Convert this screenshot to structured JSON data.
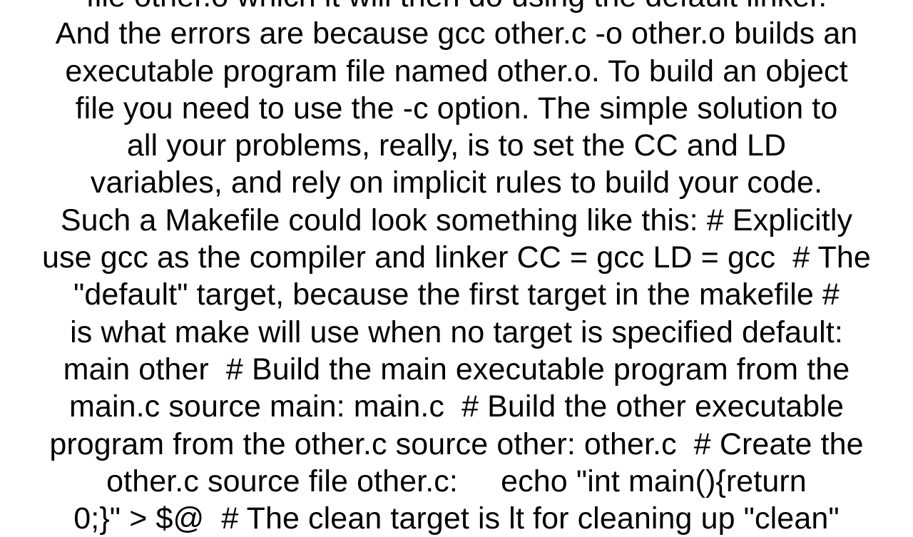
{
  "document": {
    "background_color": "#ffffff",
    "text_color": "#000000",
    "lines": [
      "file other.o which it will then do using the default linker.",
      "And the errors are because gcc other.c -o other.o builds an",
      "executable program file named other.o. To build an object",
      "file you need to use the -c option. The simple solution to",
      "all your problems, really, is to set the CC and LD",
      "variables, and rely on implicit rules to build your code.",
      "Such a Makefile could look something like this: # Explicitly",
      "use gcc as the compiler and linker CC = gcc LD = gcc  # The",
      "\"default\" target, because the first target in the makefile #",
      "is what make will use when no target is specified default:",
      "main other  # Build the main executable program from the",
      "main.c source main: main.c  # Build the other executable",
      "program from the other.c source other: other.c  # Create the",
      "other.c source file other.c:     echo \"int main(){return",
      "0;}\" > $@  # The clean target is lt for cleaning up \"clean\""
    ]
  }
}
